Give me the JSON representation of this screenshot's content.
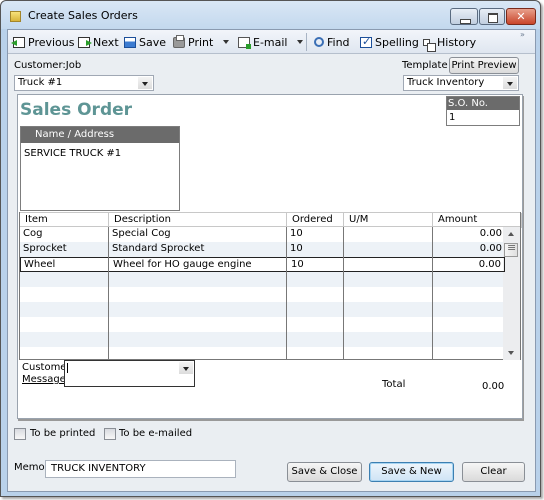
{
  "window": {
    "title": "Create Sales Orders"
  },
  "toolbar": {
    "previous": "Previous",
    "next": "Next",
    "save": "Save",
    "print": "Print",
    "email": "E-mail",
    "find": "Find",
    "spelling": "Spelling",
    "history": "History",
    "more": "»"
  },
  "customer_job": {
    "label": "Customer:Job",
    "value": "Truck #1"
  },
  "template": {
    "label": "Template",
    "value": "Truck Inventory",
    "print_preview": "Print Preview"
  },
  "form": {
    "title": "Sales Order",
    "name_address_label": "Name / Address",
    "name_address_value": "SERVICE TRUCK #1",
    "so_no_label": "S.O. No.",
    "so_no_value": "1"
  },
  "grid": {
    "columns": [
      "Item",
      "Description",
      "Ordered",
      "U/M",
      "Amount"
    ],
    "rows": [
      {
        "item": "Cog",
        "description": "Special Cog",
        "ordered": "10",
        "um": "",
        "amount": "0.00"
      },
      {
        "item": "Sprocket",
        "description": "Standard Sprocket",
        "ordered": "10",
        "um": "",
        "amount": "0.00"
      },
      {
        "item": "Wheel",
        "description": "Wheel for HO gauge engine",
        "ordered": "10",
        "um": "",
        "amount": "0.00"
      }
    ]
  },
  "customer_message": {
    "label_line1": "Customer",
    "label_line2": "Message",
    "value": ""
  },
  "total": {
    "label": "Total",
    "value": "0.00"
  },
  "options": {
    "to_be_printed": "To be printed",
    "to_be_printed_checked": false,
    "to_be_emailed": "To be e-mailed",
    "to_be_emailed_checked": false
  },
  "memo": {
    "label": "Memo",
    "value": "TRUCK INVENTORY"
  },
  "buttons": {
    "save_close": "Save & Close",
    "save_new": "Save & New",
    "clear": "Clear"
  }
}
